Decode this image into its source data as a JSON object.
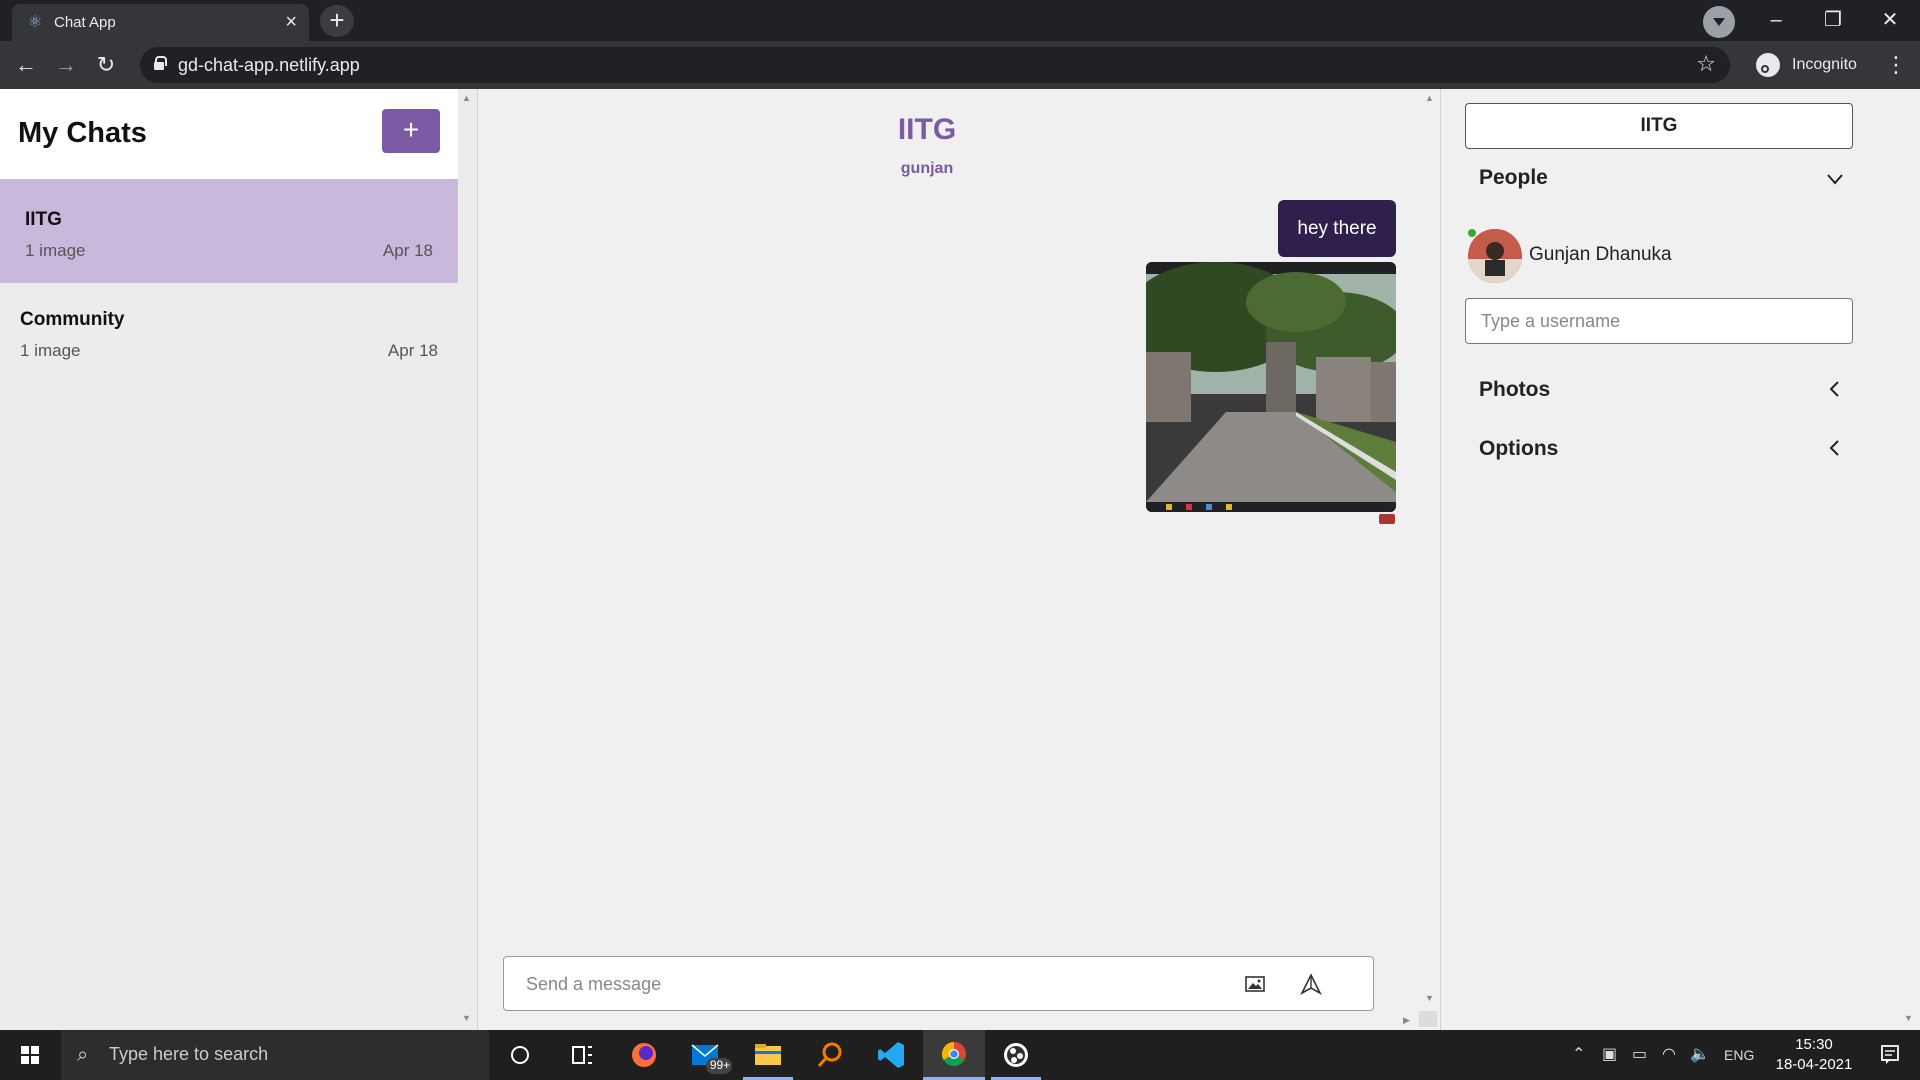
{
  "browser": {
    "tab_title": "Chat App",
    "url": "gd-chat-app.netlify.app",
    "profile_label": "Incognito"
  },
  "left_panel": {
    "title": "My Chats",
    "add_label": "+",
    "chats": [
      {
        "name": "IITG",
        "preview": "1 image",
        "date": "Apr 18",
        "active": true
      },
      {
        "name": "Community",
        "preview": "1 image",
        "date": "Apr 18",
        "active": false
      }
    ]
  },
  "conversation": {
    "title": "IITG",
    "subtitle": "gunjan",
    "messages": [
      {
        "type": "text",
        "text": "hey there"
      },
      {
        "type": "image",
        "alt": "Campus road image"
      }
    ],
    "input_placeholder": "Send a message"
  },
  "right_panel": {
    "chat_name": "IITG",
    "people_label": "People",
    "people": [
      {
        "name": "Gunjan Dhanuka",
        "online": true
      }
    ],
    "username_placeholder": "Type a username",
    "photos_label": "Photos",
    "options_label": "Options"
  },
  "taskbar": {
    "search_placeholder": "Type here to search",
    "mail_badge": "99+",
    "language": "ENG",
    "time": "15:30",
    "date": "18-04-2021"
  },
  "colors": {
    "accent": "#7c59a3",
    "active_chat": "#c8b9dc",
    "bubble": "#2e1f4d"
  }
}
